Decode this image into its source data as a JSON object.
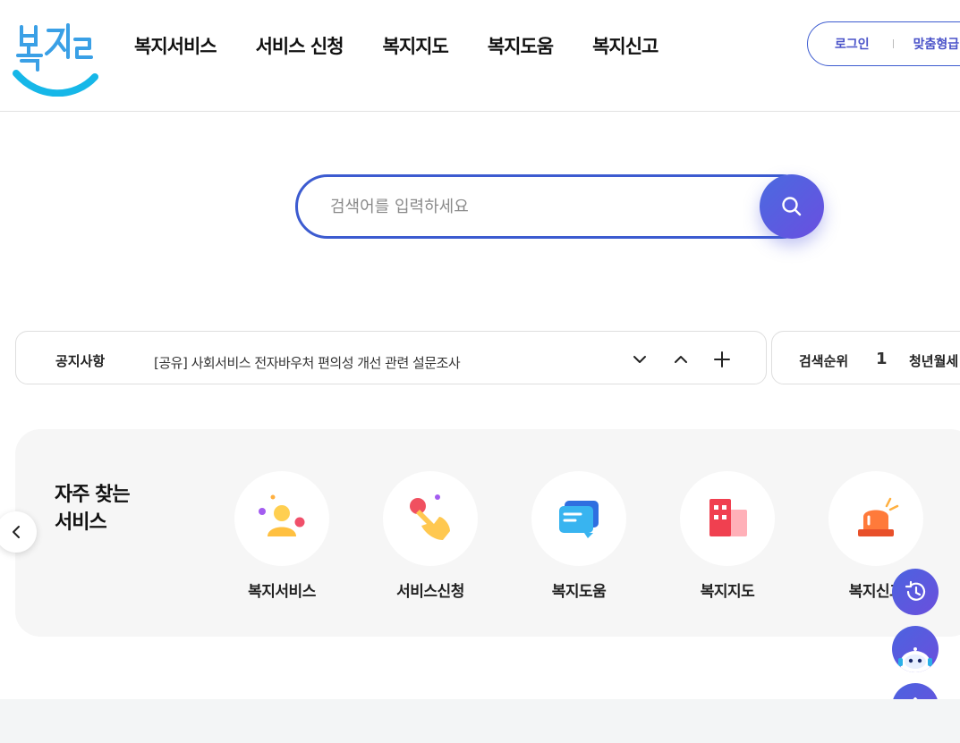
{
  "header": {
    "logo_text": "복지로",
    "nav": [
      "복지서비스",
      "서비스 신청",
      "복지지도",
      "복지도움",
      "복지신고"
    ],
    "login_label": "로그인",
    "custom_label": "맞춤형급"
  },
  "search": {
    "placeholder": "검색어를 입력하세요"
  },
  "notice": {
    "title": "공지사항",
    "text": "[공유] 사회서비스 전자바우처 편의성 개선 관련 설문조사"
  },
  "ranking": {
    "title": "검색순위",
    "number": "1",
    "text": "청년월세"
  },
  "frequent": {
    "title_line1": "자주 찾는",
    "title_line2": "서비스",
    "items": [
      {
        "label": "복지서비스",
        "icon": "person-icon"
      },
      {
        "label": "서비스신청",
        "icon": "hand-tap-icon"
      },
      {
        "label": "복지도움",
        "icon": "chat-card-icon"
      },
      {
        "label": "복지지도",
        "icon": "building-icon"
      },
      {
        "label": "복지신고",
        "icon": "siren-icon"
      }
    ]
  },
  "colors": {
    "brand_blue": "#3c5bd0",
    "accent_purple": "#6a4fe0",
    "logo_cyan": "#16b7e8"
  }
}
